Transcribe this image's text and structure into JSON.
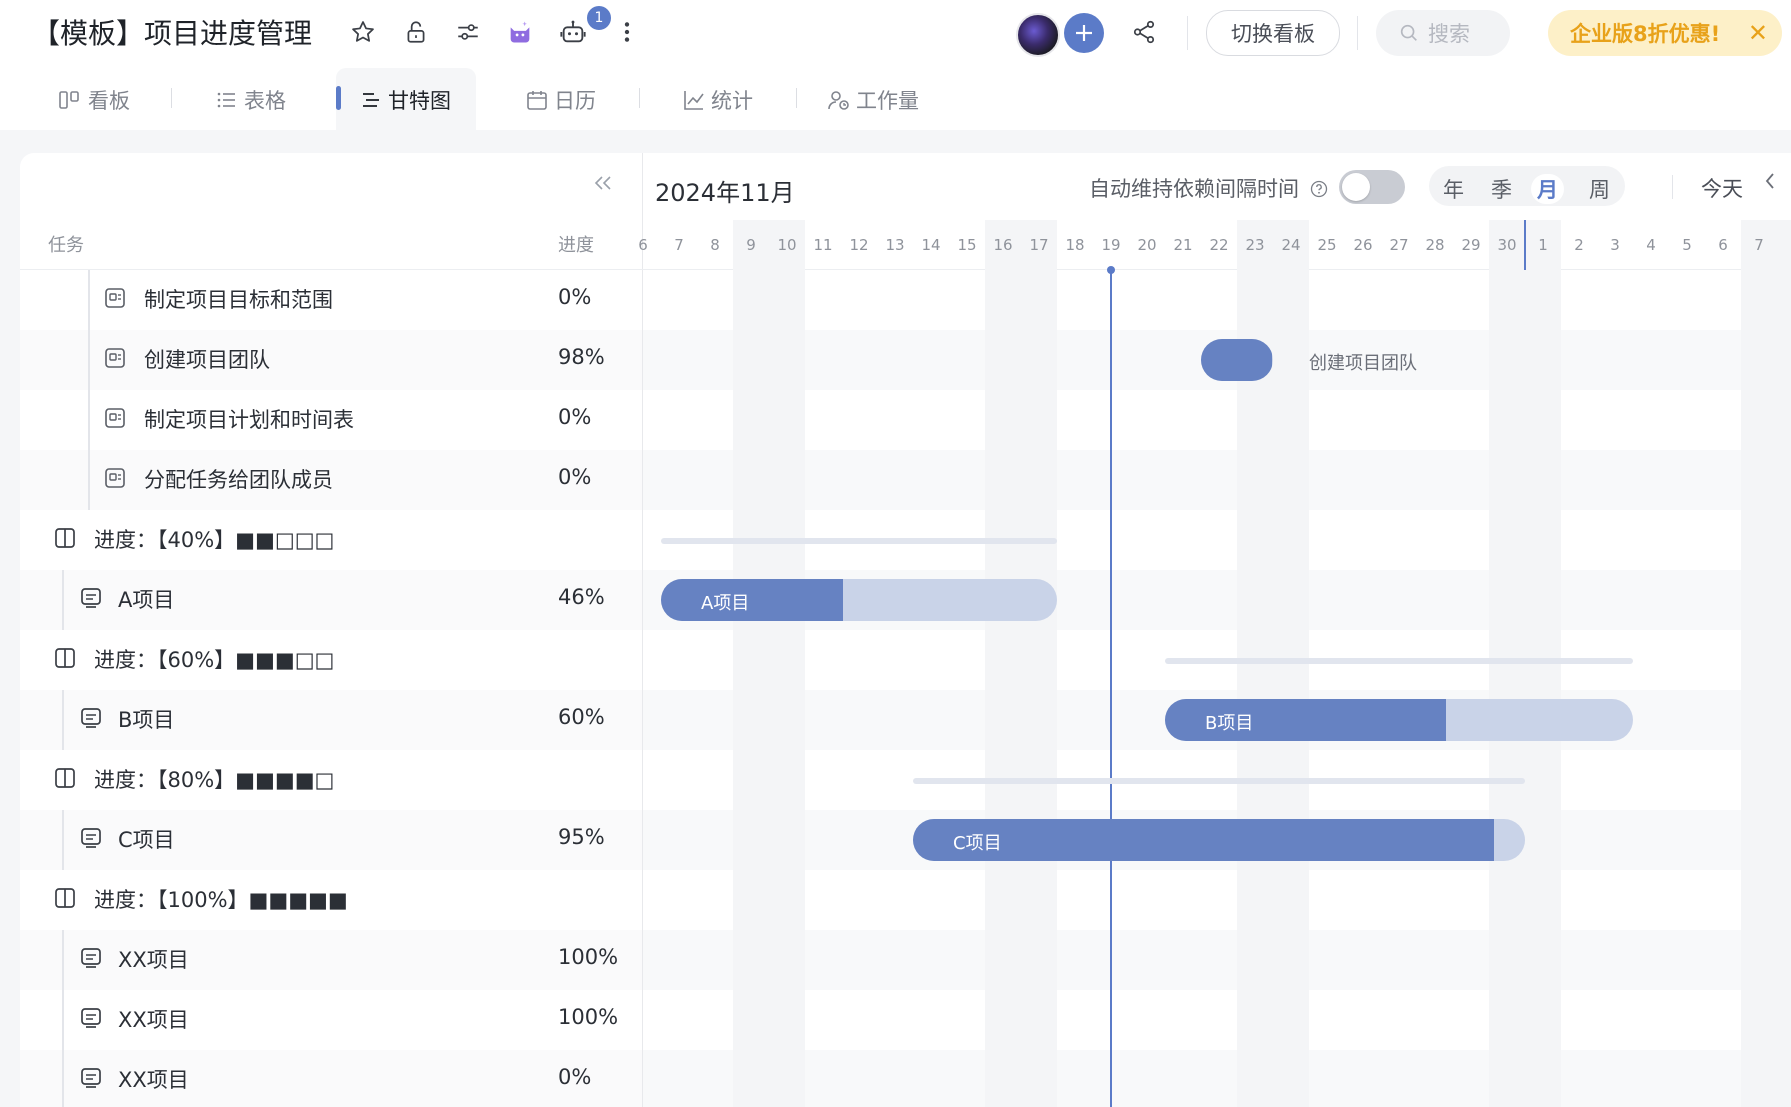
{
  "header": {
    "title": "【模板】项目进度管理",
    "notification_count": "1",
    "switch_board": "切换看板",
    "search_placeholder": "搜索",
    "promo": "企业版8折优惠!"
  },
  "tabs": [
    {
      "label": "看板"
    },
    {
      "label": "表格"
    },
    {
      "label": "甘特图"
    },
    {
      "label": "日历"
    },
    {
      "label": "统计"
    },
    {
      "label": "工作量"
    }
  ],
  "task_table": {
    "col_task": "任务",
    "col_progress": "进度",
    "rows": [
      {
        "type": "task",
        "name": "制定项目目标和范围",
        "progress": "0%"
      },
      {
        "type": "task",
        "name": "创建项目团队",
        "progress": "98%"
      },
      {
        "type": "task",
        "name": "制定项目计划和时间表",
        "progress": "0%"
      },
      {
        "type": "task",
        "name": "分配任务给团队成员",
        "progress": "0%"
      },
      {
        "type": "group",
        "name": "进度：【40%】■■□□□"
      },
      {
        "type": "project",
        "name": "A项目",
        "progress": "46%"
      },
      {
        "type": "group",
        "name": "进度：【60%】■■■□□"
      },
      {
        "type": "project",
        "name": "B项目",
        "progress": "60%"
      },
      {
        "type": "group",
        "name": "进度：【80%】■■■■□"
      },
      {
        "type": "project",
        "name": "C项目",
        "progress": "95%"
      },
      {
        "type": "group",
        "name": "进度：【100%】■■■■■"
      },
      {
        "type": "project",
        "name": "XX项目",
        "progress": "100%"
      },
      {
        "type": "project",
        "name": "XX项目",
        "progress": "100%"
      },
      {
        "type": "project",
        "name": "XX项目",
        "progress": "0%"
      }
    ]
  },
  "gantt": {
    "month_label": "2024年11月",
    "auto_dependency_label": "自动维持依赖间隔时间",
    "auto_dependency_on": false,
    "scales": [
      "年",
      "季",
      "月",
      "周"
    ],
    "active_scale": "月",
    "today_button": "今天",
    "today": "11-19",
    "days": [
      "6",
      "7",
      "8",
      "9",
      "10",
      "11",
      "12",
      "13",
      "14",
      "15",
      "16",
      "17",
      "18",
      "19",
      "20",
      "21",
      "22",
      "23",
      "24",
      "25",
      "26",
      "27",
      "28",
      "29",
      "30",
      "1",
      "2",
      "3",
      "4",
      "5",
      "6",
      "7"
    ],
    "bars": [
      {
        "row": 1,
        "start": "11-22",
        "end": "11-23",
        "progress": 0.98,
        "label": "",
        "side_label": "创建项目团队"
      },
      {
        "row": 4,
        "start": "11-07",
        "end": "11-17",
        "thin": true
      },
      {
        "row": 5,
        "start": "11-07",
        "end": "11-17",
        "progress": 0.46,
        "label": "A项目"
      },
      {
        "row": 6,
        "start": "11-21",
        "end": "12-03",
        "thin": true
      },
      {
        "row": 7,
        "start": "11-21",
        "end": "12-03",
        "progress": 0.6,
        "label": "B项目"
      },
      {
        "row": 8,
        "start": "11-14",
        "end": "11-30",
        "thin": true
      },
      {
        "row": 9,
        "start": "11-14",
        "end": "11-30",
        "progress": 0.95,
        "label": "C项目"
      }
    ]
  },
  "colors": {
    "accent": "#5b7bc8",
    "bar_fill": "#6682c2",
    "bar_rest": "#c9d3e8",
    "promo_text": "#e8a21a"
  }
}
